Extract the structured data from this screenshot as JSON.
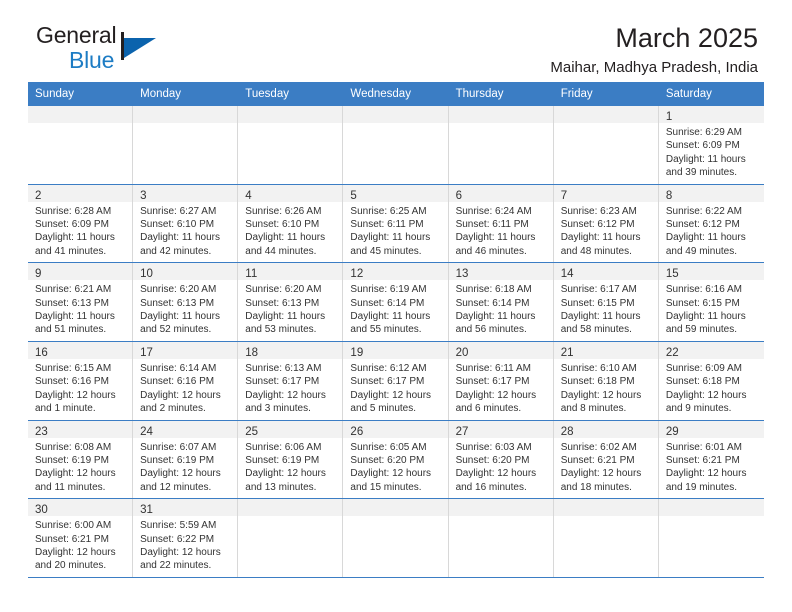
{
  "logo": {
    "word_one": "General",
    "word_two": "Blue",
    "triangle_color": "#0b63ad",
    "blue_text_color": "#1d7cc4"
  },
  "header": {
    "title": "March 2025",
    "subtitle": "Maihar, Madhya Pradesh, India"
  },
  "theme": {
    "header_blue": "#3b7dc4",
    "daynum_band": "#f2f2f2",
    "cell_border": "#d8d8d8"
  },
  "weekdays": [
    "Sunday",
    "Monday",
    "Tuesday",
    "Wednesday",
    "Thursday",
    "Friday",
    "Saturday"
  ],
  "weeks": [
    [
      {
        "empty": true
      },
      {
        "empty": true
      },
      {
        "empty": true
      },
      {
        "empty": true
      },
      {
        "empty": true
      },
      {
        "empty": true
      },
      {
        "day": "1",
        "sunrise": "Sunrise: 6:29 AM",
        "sunset": "Sunset: 6:09 PM",
        "daylight": "Daylight: 11 hours and 39 minutes."
      }
    ],
    [
      {
        "day": "2",
        "sunrise": "Sunrise: 6:28 AM",
        "sunset": "Sunset: 6:09 PM",
        "daylight": "Daylight: 11 hours and 41 minutes."
      },
      {
        "day": "3",
        "sunrise": "Sunrise: 6:27 AM",
        "sunset": "Sunset: 6:10 PM",
        "daylight": "Daylight: 11 hours and 42 minutes."
      },
      {
        "day": "4",
        "sunrise": "Sunrise: 6:26 AM",
        "sunset": "Sunset: 6:10 PM",
        "daylight": "Daylight: 11 hours and 44 minutes."
      },
      {
        "day": "5",
        "sunrise": "Sunrise: 6:25 AM",
        "sunset": "Sunset: 6:11 PM",
        "daylight": "Daylight: 11 hours and 45 minutes."
      },
      {
        "day": "6",
        "sunrise": "Sunrise: 6:24 AM",
        "sunset": "Sunset: 6:11 PM",
        "daylight": "Daylight: 11 hours and 46 minutes."
      },
      {
        "day": "7",
        "sunrise": "Sunrise: 6:23 AM",
        "sunset": "Sunset: 6:12 PM",
        "daylight": "Daylight: 11 hours and 48 minutes."
      },
      {
        "day": "8",
        "sunrise": "Sunrise: 6:22 AM",
        "sunset": "Sunset: 6:12 PM",
        "daylight": "Daylight: 11 hours and 49 minutes."
      }
    ],
    [
      {
        "day": "9",
        "sunrise": "Sunrise: 6:21 AM",
        "sunset": "Sunset: 6:13 PM",
        "daylight": "Daylight: 11 hours and 51 minutes."
      },
      {
        "day": "10",
        "sunrise": "Sunrise: 6:20 AM",
        "sunset": "Sunset: 6:13 PM",
        "daylight": "Daylight: 11 hours and 52 minutes."
      },
      {
        "day": "11",
        "sunrise": "Sunrise: 6:20 AM",
        "sunset": "Sunset: 6:13 PM",
        "daylight": "Daylight: 11 hours and 53 minutes."
      },
      {
        "day": "12",
        "sunrise": "Sunrise: 6:19 AM",
        "sunset": "Sunset: 6:14 PM",
        "daylight": "Daylight: 11 hours and 55 minutes."
      },
      {
        "day": "13",
        "sunrise": "Sunrise: 6:18 AM",
        "sunset": "Sunset: 6:14 PM",
        "daylight": "Daylight: 11 hours and 56 minutes."
      },
      {
        "day": "14",
        "sunrise": "Sunrise: 6:17 AM",
        "sunset": "Sunset: 6:15 PM",
        "daylight": "Daylight: 11 hours and 58 minutes."
      },
      {
        "day": "15",
        "sunrise": "Sunrise: 6:16 AM",
        "sunset": "Sunset: 6:15 PM",
        "daylight": "Daylight: 11 hours and 59 minutes."
      }
    ],
    [
      {
        "day": "16",
        "sunrise": "Sunrise: 6:15 AM",
        "sunset": "Sunset: 6:16 PM",
        "daylight": "Daylight: 12 hours and 1 minute."
      },
      {
        "day": "17",
        "sunrise": "Sunrise: 6:14 AM",
        "sunset": "Sunset: 6:16 PM",
        "daylight": "Daylight: 12 hours and 2 minutes."
      },
      {
        "day": "18",
        "sunrise": "Sunrise: 6:13 AM",
        "sunset": "Sunset: 6:17 PM",
        "daylight": "Daylight: 12 hours and 3 minutes."
      },
      {
        "day": "19",
        "sunrise": "Sunrise: 6:12 AM",
        "sunset": "Sunset: 6:17 PM",
        "daylight": "Daylight: 12 hours and 5 minutes."
      },
      {
        "day": "20",
        "sunrise": "Sunrise: 6:11 AM",
        "sunset": "Sunset: 6:17 PM",
        "daylight": "Daylight: 12 hours and 6 minutes."
      },
      {
        "day": "21",
        "sunrise": "Sunrise: 6:10 AM",
        "sunset": "Sunset: 6:18 PM",
        "daylight": "Daylight: 12 hours and 8 minutes."
      },
      {
        "day": "22",
        "sunrise": "Sunrise: 6:09 AM",
        "sunset": "Sunset: 6:18 PM",
        "daylight": "Daylight: 12 hours and 9 minutes."
      }
    ],
    [
      {
        "day": "23",
        "sunrise": "Sunrise: 6:08 AM",
        "sunset": "Sunset: 6:19 PM",
        "daylight": "Daylight: 12 hours and 11 minutes."
      },
      {
        "day": "24",
        "sunrise": "Sunrise: 6:07 AM",
        "sunset": "Sunset: 6:19 PM",
        "daylight": "Daylight: 12 hours and 12 minutes."
      },
      {
        "day": "25",
        "sunrise": "Sunrise: 6:06 AM",
        "sunset": "Sunset: 6:19 PM",
        "daylight": "Daylight: 12 hours and 13 minutes."
      },
      {
        "day": "26",
        "sunrise": "Sunrise: 6:05 AM",
        "sunset": "Sunset: 6:20 PM",
        "daylight": "Daylight: 12 hours and 15 minutes."
      },
      {
        "day": "27",
        "sunrise": "Sunrise: 6:03 AM",
        "sunset": "Sunset: 6:20 PM",
        "daylight": "Daylight: 12 hours and 16 minutes."
      },
      {
        "day": "28",
        "sunrise": "Sunrise: 6:02 AM",
        "sunset": "Sunset: 6:21 PM",
        "daylight": "Daylight: 12 hours and 18 minutes."
      },
      {
        "day": "29",
        "sunrise": "Sunrise: 6:01 AM",
        "sunset": "Sunset: 6:21 PM",
        "daylight": "Daylight: 12 hours and 19 minutes."
      }
    ],
    [
      {
        "day": "30",
        "sunrise": "Sunrise: 6:00 AM",
        "sunset": "Sunset: 6:21 PM",
        "daylight": "Daylight: 12 hours and 20 minutes."
      },
      {
        "day": "31",
        "sunrise": "Sunrise: 5:59 AM",
        "sunset": "Sunset: 6:22 PM",
        "daylight": "Daylight: 12 hours and 22 minutes."
      },
      {
        "empty": true
      },
      {
        "empty": true
      },
      {
        "empty": true
      },
      {
        "empty": true
      },
      {
        "empty": true
      }
    ]
  ]
}
